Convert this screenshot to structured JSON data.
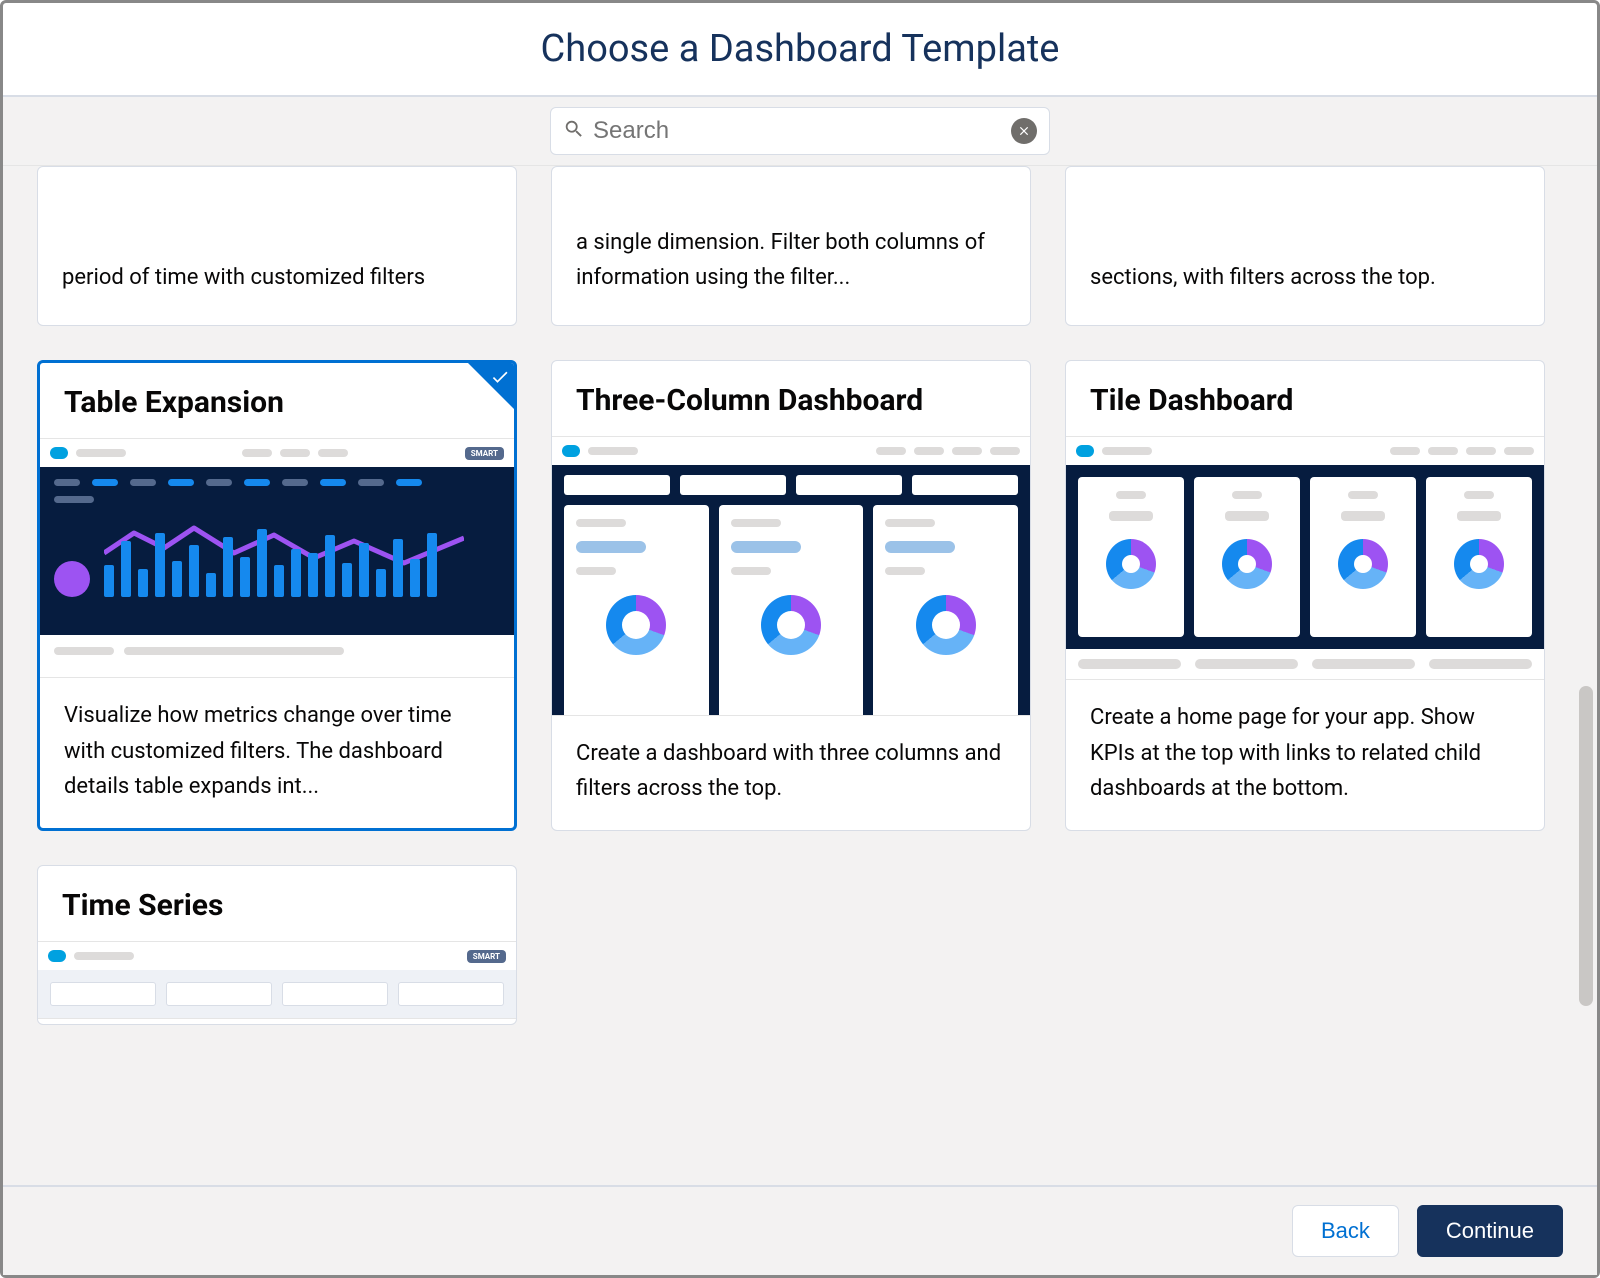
{
  "header": {
    "title": "Choose a Dashboard Template"
  },
  "search": {
    "placeholder": "Search",
    "value": ""
  },
  "row_top": [
    {
      "desc": "period of time with customized filters"
    },
    {
      "desc": "a single dimension. Filter both columns of information using the filter..."
    },
    {
      "desc": "sections, with filters across the top."
    }
  ],
  "cards": [
    {
      "id": "table-expansion",
      "title": "Table Expansion",
      "desc": "Visualize how metrics change over time with customized filters. The dashboard details table expands int...",
      "selected": true,
      "smart": true
    },
    {
      "id": "three-column",
      "title": "Three-Column Dashboard",
      "desc": "Create a dashboard with three columns and filters across the top.",
      "selected": false,
      "smart": false
    },
    {
      "id": "tile-dashboard",
      "title": "Tile Dashboard",
      "desc": "Create a home page for your app. Show KPIs at the top with links to related child dashboards at the bottom.",
      "selected": false,
      "smart": false
    }
  ],
  "row_bottom": [
    {
      "id": "time-series",
      "title": "Time Series",
      "smart": true
    }
  ],
  "footer": {
    "back": "Back",
    "continue": "Continue"
  },
  "smart_label": "SMART"
}
